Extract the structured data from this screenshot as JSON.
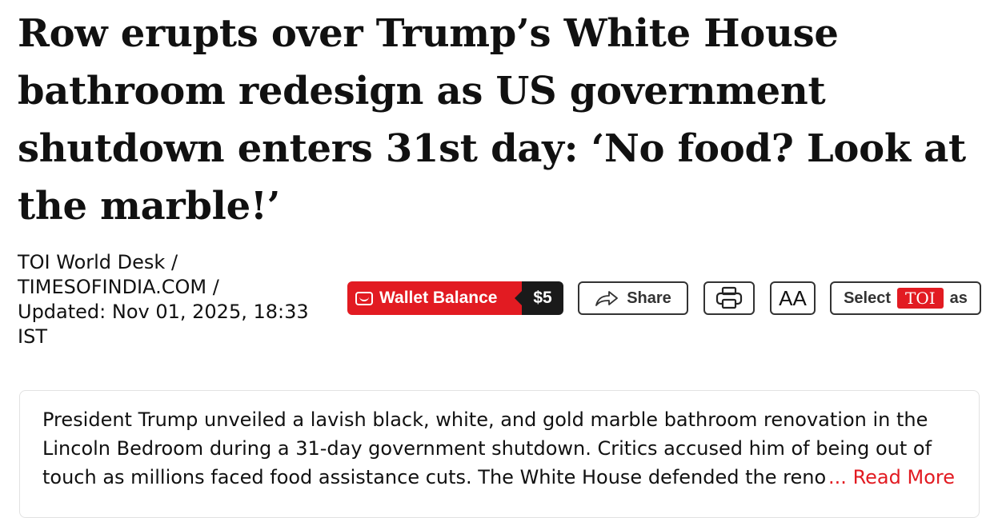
{
  "article": {
    "headline": "Row erupts over Trump’s White House bathroom redesign as US government shutdown enters 31st day: ‘No food? Look at the marble!’",
    "byline": {
      "author": "TOI World Desk /",
      "source": "TIMESOFINDIA.COM /",
      "updated": "Updated: Nov 01, 2025, 18:33",
      "timezone": "IST"
    },
    "summary": "President Trump unveiled a lavish black, white, and gold marble bathroom renovation in the Lincoln Bedroom during a 31-day government shutdown. Critics accused him of being out of touch as millions faced food assistance cuts. The White House defended the renovation",
    "read_more": "... Read More"
  },
  "toolbar": {
    "wallet_label": "Wallet Balance",
    "wallet_amount": "$5",
    "share_label": "Share",
    "aa_label": "AA",
    "select_prefix": "Select",
    "select_brand": "TOI",
    "select_suffix": "as"
  },
  "colors": {
    "accent": "#e21b22",
    "dark": "#1a1a1a",
    "text": "#111111",
    "border": "#333333"
  },
  "icons": {
    "wallet": "wallet-icon",
    "share": "share-arrow-icon",
    "print": "printer-icon"
  }
}
